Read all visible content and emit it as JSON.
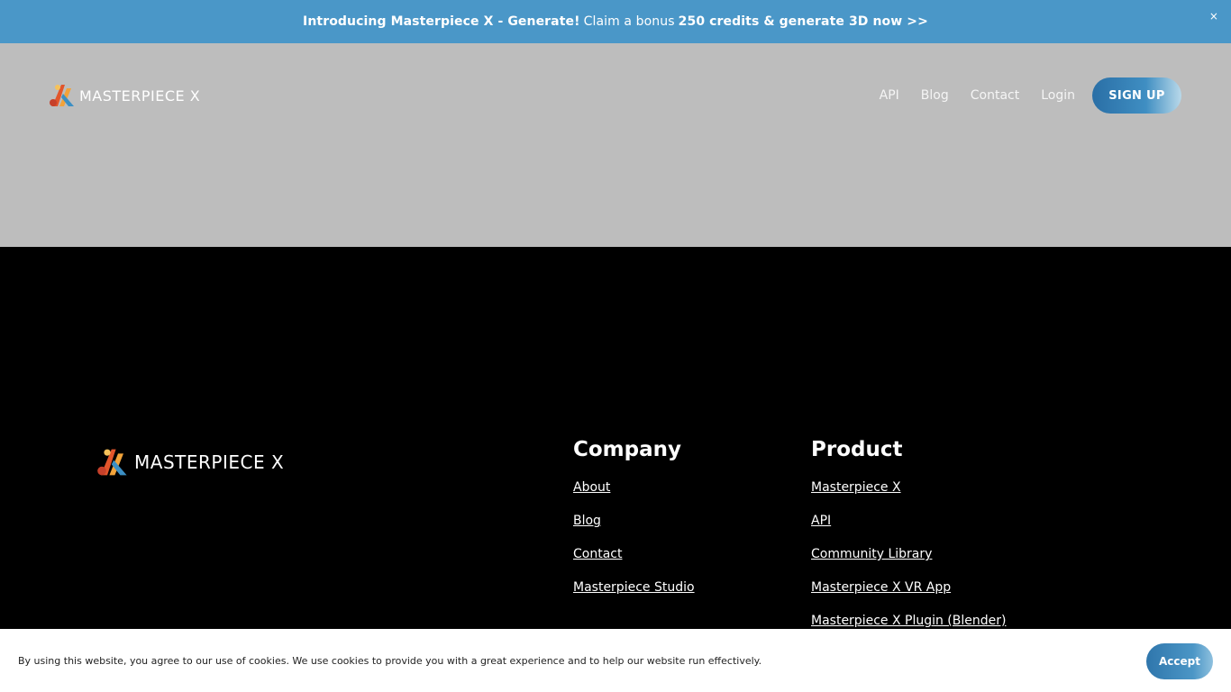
{
  "announcement": {
    "part1": "Introducing Masterpiece X - Generate!",
    "part2": "Claim a bonus",
    "part3": "250 credits & generate 3D now >>",
    "close": "×"
  },
  "header": {
    "logo_text": "MASTERPIECE X",
    "nav": [
      "API",
      "Blog",
      "Contact",
      "Login"
    ],
    "signup_label": "SIGN UP"
  },
  "footer": {
    "logo_text": "MASTERPIECE X",
    "company": {
      "title": "Company",
      "links": [
        "About",
        "Blog",
        "Contact",
        "Masterpiece Studio"
      ]
    },
    "product": {
      "title": "Product",
      "links": [
        "Masterpiece X",
        "API",
        "Community Library",
        "Masterpiece X VR App",
        "Masterpiece X Plugin (Blender)"
      ]
    }
  },
  "cookie": {
    "text": "By using this website, you agree to our use of cookies. We use cookies to provide you with a great experience and to help our website run effectively.",
    "accept_label": "Accept"
  },
  "colors": {
    "announcement_bg": "#4a97c8",
    "header_bg": "#bdbdbd",
    "footer_bg": "#000000",
    "accent": "#3f8ec2"
  }
}
